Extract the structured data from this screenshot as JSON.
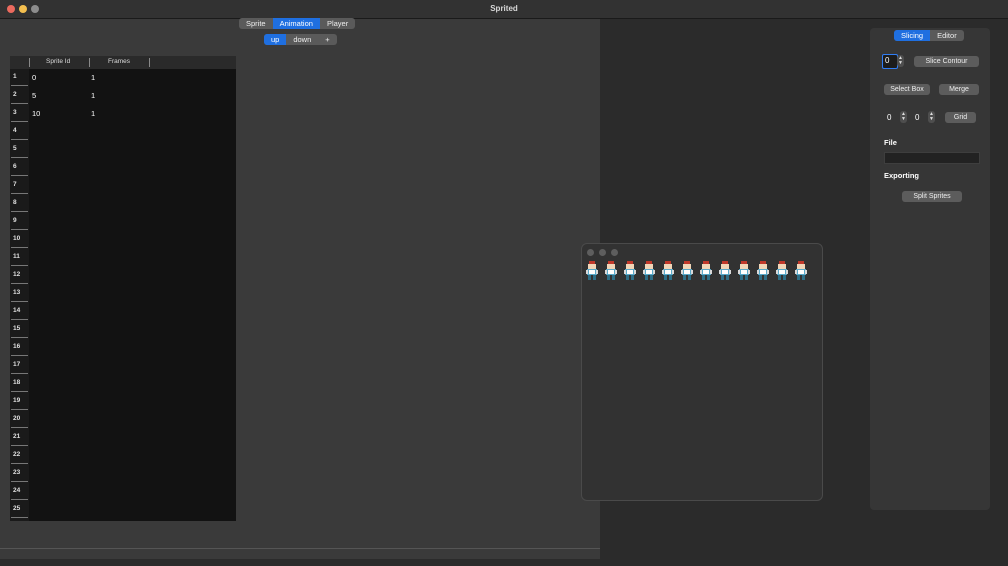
{
  "window": {
    "title": "Sprited"
  },
  "top_tabs": [
    {
      "label": "Sprite",
      "selected": false
    },
    {
      "label": "Animation",
      "selected": true
    },
    {
      "label": "Player",
      "selected": false
    }
  ],
  "anim_tabs": [
    {
      "label": "up",
      "selected": true
    },
    {
      "label": "down",
      "selected": false
    },
    {
      "label": "+",
      "selected": false
    }
  ],
  "table": {
    "columns": [
      "Sprite Id",
      "Frames"
    ],
    "rows": [
      {
        "sprite_id": "0",
        "frames": "1"
      },
      {
        "sprite_id": "5",
        "frames": "1"
      },
      {
        "sprite_id": "10",
        "frames": "1"
      }
    ],
    "row_numbers": [
      "1",
      "2",
      "3",
      "4",
      "5",
      "6",
      "7",
      "8",
      "9",
      "10",
      "11",
      "12",
      "13",
      "14",
      "15",
      "16",
      "17",
      "18",
      "19",
      "20",
      "21",
      "22",
      "23",
      "24",
      "25"
    ]
  },
  "inspector": {
    "tabs": [
      {
        "label": "Slicing",
        "selected": true
      },
      {
        "label": "Editor",
        "selected": false
      }
    ],
    "contour_value": "0",
    "slice_contour_label": "Slice Contour",
    "select_box_label": "Select Box",
    "merge_label": "Merge",
    "grid_x_value": "0",
    "grid_y_value": "0",
    "grid_label": "Grid",
    "file_label": "File",
    "file_value": "",
    "exporting_label": "Exporting",
    "split_sprites_label": "Split Sprites"
  },
  "preview": {
    "sprite_count": 12
  },
  "colors": {
    "accent": "#1f6fe0"
  }
}
